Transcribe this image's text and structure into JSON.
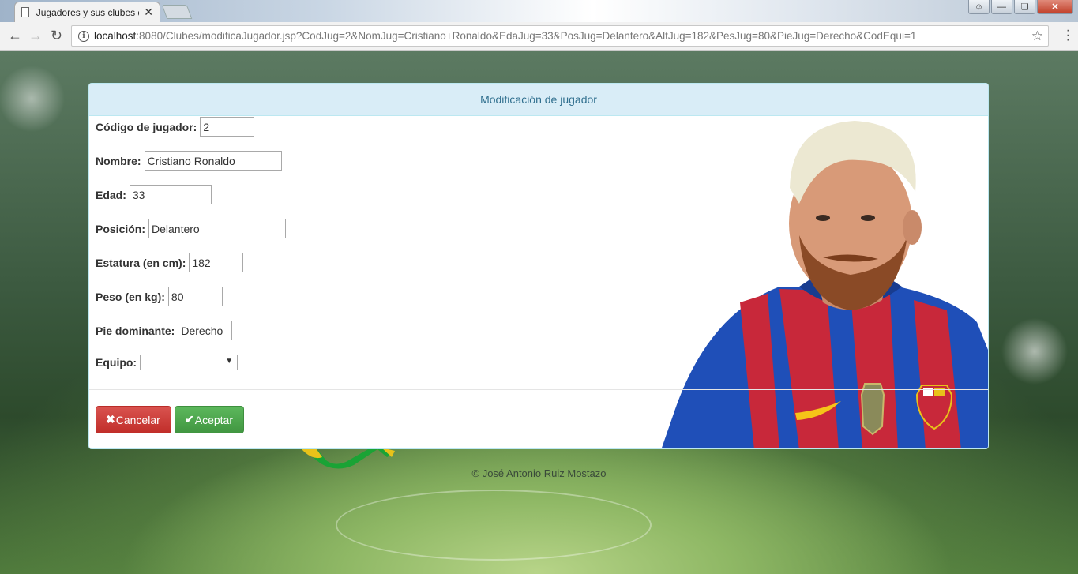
{
  "browser": {
    "tab_title": "Jugadores y sus clubes d",
    "url_host": "localhost",
    "url_rest": ":8080/Clubes/modificaJugador.jsp?CodJug=2&NomJug=Cristiano+Ronaldo&EdaJug=33&PosJug=Delantero&AltJug=182&PesJug=80&PieJug=Derecho&CodEqui=1"
  },
  "panel": {
    "heading": "Modificación de jugador"
  },
  "form": {
    "codigo": {
      "label": "Código de jugador:",
      "value": "2"
    },
    "nombre": {
      "label": "Nombre:",
      "value": "Cristiano Ronaldo"
    },
    "edad": {
      "label": "Edad:",
      "value": "33"
    },
    "posicion": {
      "label": "Posición:",
      "value": "Delantero"
    },
    "estatura": {
      "label": "Estatura (en cm):",
      "value": "182"
    },
    "peso": {
      "label": "Peso (en kg):",
      "value": "80"
    },
    "pie": {
      "label": "Pie dominante:",
      "value": "Derecho"
    },
    "equipo": {
      "label": "Equipo:",
      "value": ""
    }
  },
  "buttons": {
    "cancel": "Cancelar",
    "accept": "Aceptar"
  },
  "footer": "© José Antonio Ruiz Mostazo",
  "colors": {
    "heading_bg": "#d9edf7",
    "heading_text": "#31708f",
    "danger": "#d9534f",
    "success": "#5cb85c"
  },
  "icons": [
    "page-icon",
    "close-icon",
    "back-icon",
    "forward-icon",
    "reload-icon",
    "info-icon",
    "star-icon",
    "menu-icon",
    "times-icon",
    "check-icon",
    "chevron-down-icon"
  ]
}
